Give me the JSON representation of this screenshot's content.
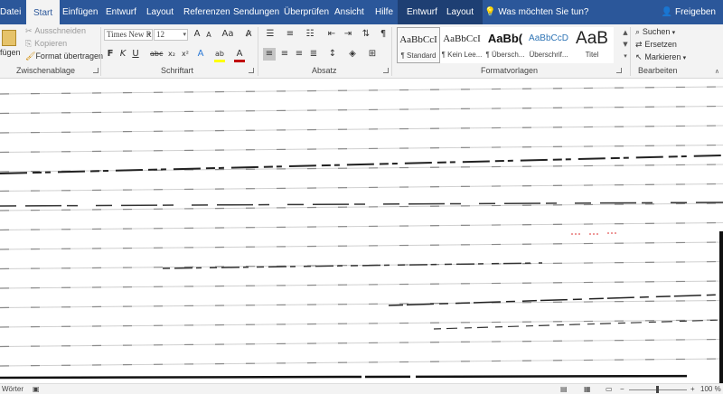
{
  "tabs": [
    {
      "label": "Datei",
      "active": false
    },
    {
      "label": "Start",
      "active": true
    },
    {
      "label": "Einfügen",
      "active": false
    },
    {
      "label": "Entwurf",
      "active": false
    },
    {
      "label": "Layout",
      "active": false
    },
    {
      "label": "Referenzen",
      "active": false
    },
    {
      "label": "Sendungen",
      "active": false
    },
    {
      "label": "Überprüfen",
      "active": false
    },
    {
      "label": "Ansicht",
      "active": false
    },
    {
      "label": "Hilfe",
      "active": false
    }
  ],
  "context_tabs": [
    "Entwurf",
    "Layout"
  ],
  "tell_me": "Was möchten Sie tun?",
  "share": "Freigeben",
  "clipboard": {
    "paste": "fügen",
    "cut": "Ausschneiden",
    "copy": "Kopieren",
    "format_painter": "Format übertragen",
    "label": "Zwischenablage"
  },
  "font": {
    "name": "Times New R",
    "size": "12",
    "label": "Schriftart",
    "grow": "A",
    "shrink": "A",
    "case": "Aa",
    "bold": "F",
    "italic": "K",
    "underline": "U",
    "strike": "abc",
    "subscript": "x₂",
    "superscript": "x²",
    "effects": "A",
    "highlight": "ab",
    "color": "A",
    "highlight_color": "#ffff00",
    "font_color": "#c00000"
  },
  "paragraph": {
    "label": "Absatz",
    "pilcrow": "¶"
  },
  "styles": {
    "label": "Formatvorlagen",
    "items": [
      {
        "sample": "AaBbCcI",
        "name": "¶ Standard",
        "selected": true
      },
      {
        "sample": "AaBbCcI",
        "name": "¶ Kein Lee...",
        "selected": false
      },
      {
        "sample": "AaBb(",
        "name": "¶ Übersch...",
        "selected": false
      },
      {
        "sample": "AaBbCcD",
        "name": "Überschrif...",
        "selected": false
      },
      {
        "sample": "AaB",
        "name": "Titel",
        "selected": false
      }
    ]
  },
  "editing": {
    "label": "Bearbeiten",
    "find": "Suchen",
    "replace": "Ersetzen",
    "select": "Markieren"
  },
  "status": {
    "words": "Wörter",
    "zoom": "100 %"
  },
  "colors": {
    "ribbon_blue": "#2b579a",
    "ribbon_bg": "#f3f3f3",
    "accent": "#2b579a"
  }
}
